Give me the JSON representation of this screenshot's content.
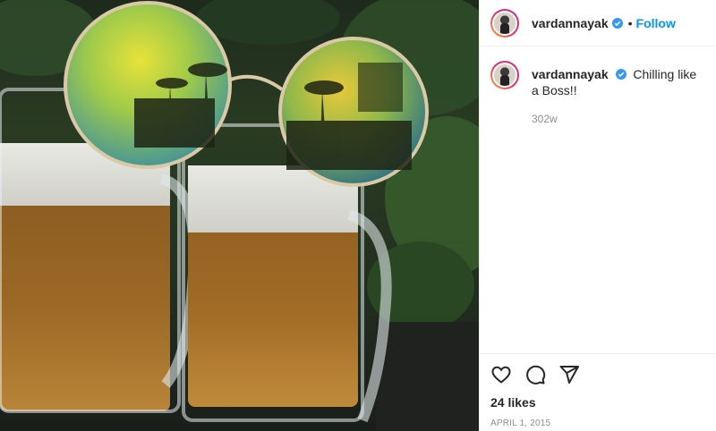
{
  "post": {
    "username": "vardannayak",
    "follow_label": "Follow",
    "dot": "•",
    "caption": "Chilling like a Boss!!",
    "time_ago": "302w",
    "likes": "24 likes",
    "date": "APRIL 1, 2015"
  },
  "colors": {
    "link": "#0095f6",
    "verified": "#3897f0",
    "muted": "#8e8e8e"
  },
  "icons": [
    "verified-badge-icon",
    "heart-icon",
    "comment-icon",
    "share-icon"
  ]
}
